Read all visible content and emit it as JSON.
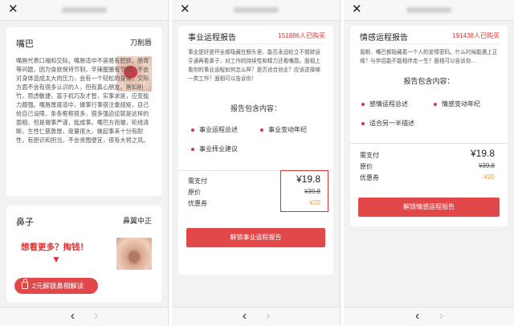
{
  "screens": [
    {
      "close_icon": "✕",
      "card_mouth": {
        "title": "嘴巴",
        "tag": "刀削唇",
        "text": "嘴唇代表口福和交际。嘴唇适中不容易有肥胖，肠胃等问题，因为食欲保持节制，辛辣腥膻有节制，不会对身体造成太大的压力，会有一个轻松的身体，交际方面不会有很多认识的人，但有真心朋友，唇如削竹，思虑敏捷，富于机巧及才智，实事求是，应变能力颇强。嘴唇厚度适中，做事行事很注重规矩，自己给自己设限，条条框框很多，很多强迫症就是这样的面相，但是做事严谨，能成事。嘴巴方而端，轮线清晰，生性仁慈敦厚，度量很大，做起事来十分有耐性，有胆识和担当，不会贪图便宜，很有大将之风。"
      },
      "card_nose": {
        "title": "鼻子",
        "tag": "鼻翼中正",
        "promo": "想看更多？掏钱！",
        "arrow": "▼",
        "unlock_label": "2元解锁鼻相解读"
      },
      "nav_back": "‹",
      "nav_forward": "›"
    },
    {
      "close_icon": "✕",
      "title": "事业运程报告",
      "buyers": "151886人已购买",
      "desc": "事业是好是坏全部隐藏在额头里，能否永远屹立不倒财运亨通再看鼻子，对工作的持续性和精力还看嘴唇。面相上看你的事业运程如何怎么样？是否适合创业？应该选择哪一类工作？面相可以告诉你！",
      "contents_heading": "报告包含内容：",
      "items": [
        "事业运程总述",
        "事业变动年纪",
        "事业择业建议"
      ],
      "pay_label": "需支付",
      "pay_price": "¥19.8",
      "orig_label": "原价",
      "orig_price": "¥39.8",
      "coupon_label": "优惠券",
      "coupon_value": "-¥20",
      "cta": "解锁事业运程报告",
      "nav_back": "‹",
      "nav_forward": "›",
      "highlight_color": "#d93030"
    },
    {
      "close_icon": "✕",
      "title": "情感运程报告",
      "buyers": "191438人已购买",
      "desc": "眉眼、嘴巴都隐藏着一个人的爱情密码。什么时候能遇上正缘？与伴侣能不能相伴走一生？面相可以告诉你…",
      "contents_heading": "报告包含内容：",
      "items": [
        "感情运程总述",
        "情感变动年纪",
        "适合另一半描述"
      ],
      "pay_label": "需支付",
      "pay_price": "¥19.8",
      "orig_label": "原价",
      "orig_price": "¥39.8",
      "coupon_label": "优惠券",
      "coupon_value": "-¥20",
      "cta": "解锁情感运程报告",
      "nav_back": "‹",
      "nav_forward": "›"
    }
  ],
  "colors": {
    "accent": "#e0484a",
    "brand_red": "#e0312f",
    "coupon": "#e6a23c"
  }
}
